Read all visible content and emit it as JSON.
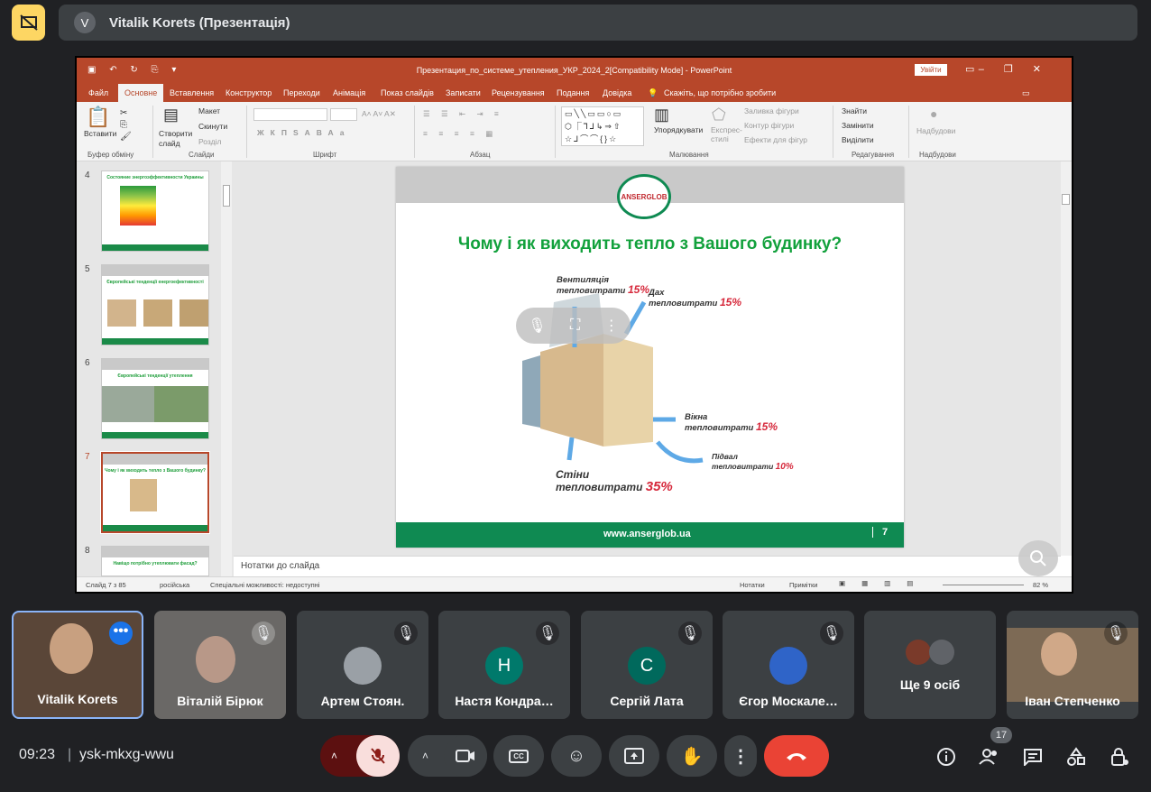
{
  "presenter_bar": {
    "avatar_letter": "V",
    "title": "Vitalik Korets (Презентація)"
  },
  "powerpoint": {
    "window_title": "Презентация_по_системе_утепления_УКР_2024_2[Compatibility Mode] - PowerPoint",
    "sign_in": "Увійти",
    "menu": [
      "Файл",
      "Основне",
      "Вставлення",
      "Конструктор",
      "Переходи",
      "Анімація",
      "Показ слайдів",
      "Записати",
      "Рецензування",
      "Подання",
      "Довідка"
    ],
    "tell_me": "Скажіть, що потрібно зробити",
    "ribbon": {
      "paste": "Вставити",
      "clipboard": "Буфер обміну",
      "create_slide": "Створити слайд",
      "layout": "Макет",
      "reset": "Скинути",
      "section": "Розділ",
      "slides": "Слайди",
      "font": "Шрифт",
      "paragraph": "Абзац",
      "arrange": "Упорядкувати",
      "quick_styles": "Експрес-стилі",
      "shape_fill": "Заливка фігури",
      "shape_outline": "Контур фігури",
      "shape_effects": "Ефекти для фігур",
      "drawing": "Малювання",
      "find": "Знайти",
      "replace": "Замінити",
      "select": "Виділити",
      "editing": "Редагування",
      "addins": "Надбудови",
      "addins_group": "Надбудови"
    },
    "thumbnails": [
      {
        "num": "4",
        "title": "Состояние энергоэффективности Украины"
      },
      {
        "num": "5",
        "title": "Європейські тенденції енергоефективності"
      },
      {
        "num": "6",
        "title": "Європейські тенденції утеплення"
      },
      {
        "num": "7",
        "title": "Чому і як виходить тепло з Вашого будинку?"
      },
      {
        "num": "8",
        "title": "Навіщо потрібно утеплювати фасад?"
      }
    ],
    "slide": {
      "logo": "ANSERGLOB",
      "title": "Чому і як виходить тепло з Вашого будинку?",
      "vent_a": "Вентиляція",
      "vent_b": "тепловитрати",
      "vent_pct": "15%",
      "roof_a": "Дах",
      "roof_b": "тепловитрати",
      "roof_pct": "15%",
      "win_a": "Вікна",
      "win_b": "тепловитрати",
      "win_pct": "15%",
      "base_a": "Підвал",
      "base_b": "тепловитрати",
      "base_pct": "10%",
      "walls_a": "Стіни",
      "walls_b": "тепловитрати",
      "walls_pct": "35%",
      "footer_url": "www.anserglob.ua",
      "page": "7"
    },
    "notes": "Нотатки до слайда",
    "status": {
      "slide": "Слайд 7 з 85",
      "lang": "російська",
      "accessibility": "Спеціальні можливості: недоступні",
      "notes": "Нотатки",
      "comments": "Примітки",
      "zoom": "82 %"
    }
  },
  "participants": [
    {
      "name": "Vitalik Korets"
    },
    {
      "name": "Віталій Бірюк"
    },
    {
      "name": "Артем Стоян."
    },
    {
      "name": "Настя Кондра…",
      "letter": "Н",
      "color": "#00796b"
    },
    {
      "name": "Сергій Лата",
      "letter": "С",
      "color": "#00695c"
    },
    {
      "name": "Єгор Москале…"
    },
    {
      "name": "Ще 9 осіб"
    },
    {
      "name": "Іван Степченко"
    }
  ],
  "bottom": {
    "time": "09:23",
    "meeting_code": "ysk-mkxg-wwu",
    "people_count": "17"
  },
  "colors": {
    "accent_red": "#ea4335",
    "ppt_red": "#b7472a",
    "present_yellow": "#fdd663"
  }
}
